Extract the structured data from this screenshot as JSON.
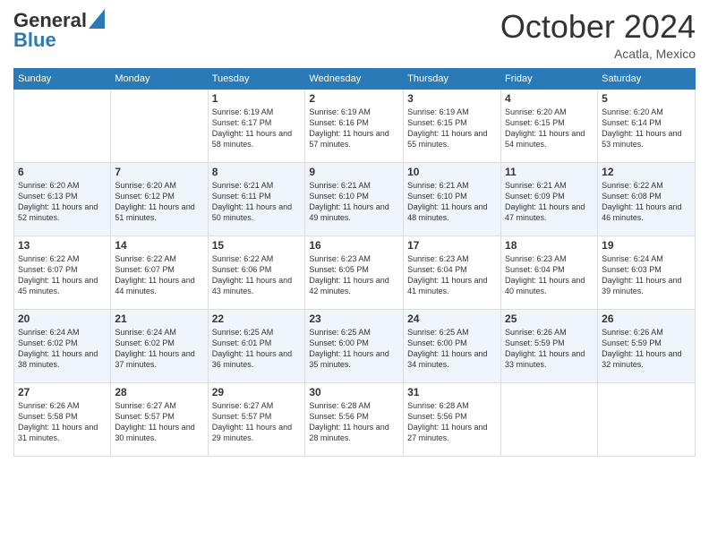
{
  "header": {
    "logo_line1": "General",
    "logo_line2": "Blue",
    "month": "October 2024",
    "location": "Acatla, Mexico"
  },
  "weekdays": [
    "Sunday",
    "Monday",
    "Tuesday",
    "Wednesday",
    "Thursday",
    "Friday",
    "Saturday"
  ],
  "weeks": [
    [
      {
        "day": "",
        "text": ""
      },
      {
        "day": "",
        "text": ""
      },
      {
        "day": "1",
        "text": "Sunrise: 6:19 AM\nSunset: 6:17 PM\nDaylight: 11 hours and 58 minutes."
      },
      {
        "day": "2",
        "text": "Sunrise: 6:19 AM\nSunset: 6:16 PM\nDaylight: 11 hours and 57 minutes."
      },
      {
        "day": "3",
        "text": "Sunrise: 6:19 AM\nSunset: 6:15 PM\nDaylight: 11 hours and 55 minutes."
      },
      {
        "day": "4",
        "text": "Sunrise: 6:20 AM\nSunset: 6:15 PM\nDaylight: 11 hours and 54 minutes."
      },
      {
        "day": "5",
        "text": "Sunrise: 6:20 AM\nSunset: 6:14 PM\nDaylight: 11 hours and 53 minutes."
      }
    ],
    [
      {
        "day": "6",
        "text": "Sunrise: 6:20 AM\nSunset: 6:13 PM\nDaylight: 11 hours and 52 minutes."
      },
      {
        "day": "7",
        "text": "Sunrise: 6:20 AM\nSunset: 6:12 PM\nDaylight: 11 hours and 51 minutes."
      },
      {
        "day": "8",
        "text": "Sunrise: 6:21 AM\nSunset: 6:11 PM\nDaylight: 11 hours and 50 minutes."
      },
      {
        "day": "9",
        "text": "Sunrise: 6:21 AM\nSunset: 6:10 PM\nDaylight: 11 hours and 49 minutes."
      },
      {
        "day": "10",
        "text": "Sunrise: 6:21 AM\nSunset: 6:10 PM\nDaylight: 11 hours and 48 minutes."
      },
      {
        "day": "11",
        "text": "Sunrise: 6:21 AM\nSunset: 6:09 PM\nDaylight: 11 hours and 47 minutes."
      },
      {
        "day": "12",
        "text": "Sunrise: 6:22 AM\nSunset: 6:08 PM\nDaylight: 11 hours and 46 minutes."
      }
    ],
    [
      {
        "day": "13",
        "text": "Sunrise: 6:22 AM\nSunset: 6:07 PM\nDaylight: 11 hours and 45 minutes."
      },
      {
        "day": "14",
        "text": "Sunrise: 6:22 AM\nSunset: 6:07 PM\nDaylight: 11 hours and 44 minutes."
      },
      {
        "day": "15",
        "text": "Sunrise: 6:22 AM\nSunset: 6:06 PM\nDaylight: 11 hours and 43 minutes."
      },
      {
        "day": "16",
        "text": "Sunrise: 6:23 AM\nSunset: 6:05 PM\nDaylight: 11 hours and 42 minutes."
      },
      {
        "day": "17",
        "text": "Sunrise: 6:23 AM\nSunset: 6:04 PM\nDaylight: 11 hours and 41 minutes."
      },
      {
        "day": "18",
        "text": "Sunrise: 6:23 AM\nSunset: 6:04 PM\nDaylight: 11 hours and 40 minutes."
      },
      {
        "day": "19",
        "text": "Sunrise: 6:24 AM\nSunset: 6:03 PM\nDaylight: 11 hours and 39 minutes."
      }
    ],
    [
      {
        "day": "20",
        "text": "Sunrise: 6:24 AM\nSunset: 6:02 PM\nDaylight: 11 hours and 38 minutes."
      },
      {
        "day": "21",
        "text": "Sunrise: 6:24 AM\nSunset: 6:02 PM\nDaylight: 11 hours and 37 minutes."
      },
      {
        "day": "22",
        "text": "Sunrise: 6:25 AM\nSunset: 6:01 PM\nDaylight: 11 hours and 36 minutes."
      },
      {
        "day": "23",
        "text": "Sunrise: 6:25 AM\nSunset: 6:00 PM\nDaylight: 11 hours and 35 minutes."
      },
      {
        "day": "24",
        "text": "Sunrise: 6:25 AM\nSunset: 6:00 PM\nDaylight: 11 hours and 34 minutes."
      },
      {
        "day": "25",
        "text": "Sunrise: 6:26 AM\nSunset: 5:59 PM\nDaylight: 11 hours and 33 minutes."
      },
      {
        "day": "26",
        "text": "Sunrise: 6:26 AM\nSunset: 5:59 PM\nDaylight: 11 hours and 32 minutes."
      }
    ],
    [
      {
        "day": "27",
        "text": "Sunrise: 6:26 AM\nSunset: 5:58 PM\nDaylight: 11 hours and 31 minutes."
      },
      {
        "day": "28",
        "text": "Sunrise: 6:27 AM\nSunset: 5:57 PM\nDaylight: 11 hours and 30 minutes."
      },
      {
        "day": "29",
        "text": "Sunrise: 6:27 AM\nSunset: 5:57 PM\nDaylight: 11 hours and 29 minutes."
      },
      {
        "day": "30",
        "text": "Sunrise: 6:28 AM\nSunset: 5:56 PM\nDaylight: 11 hours and 28 minutes."
      },
      {
        "day": "31",
        "text": "Sunrise: 6:28 AM\nSunset: 5:56 PM\nDaylight: 11 hours and 27 minutes."
      },
      {
        "day": "",
        "text": ""
      },
      {
        "day": "",
        "text": ""
      }
    ]
  ]
}
